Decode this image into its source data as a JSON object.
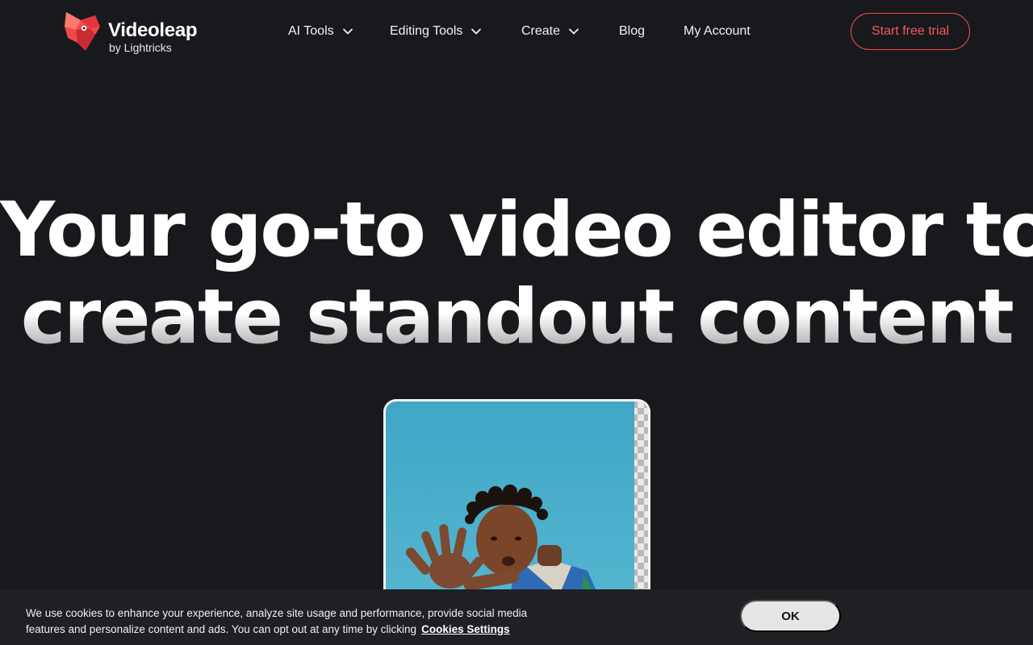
{
  "brand": {
    "name": "Videoleap",
    "sub": "by Lightricks",
    "accent": "#f0494c"
  },
  "nav": {
    "items": [
      {
        "label": "AI Tools",
        "dropdown": true
      },
      {
        "label": "Editing Tools",
        "dropdown": true
      },
      {
        "label": "Create",
        "dropdown": true
      },
      {
        "label": "Blog",
        "dropdown": false
      },
      {
        "label": "My Account",
        "dropdown": false
      }
    ],
    "cta": "Start free trial"
  },
  "hero": {
    "line1": "Your go-to video editor to",
    "line2": "create standout content"
  },
  "cookie": {
    "text": "We use cookies to enhance your experience, analyze site usage and performance, provide social media features and personalize content and ads. You can opt out at any time by clicking",
    "link": "Cookies Settings",
    "ok": "OK"
  },
  "icons": [
    "videoleap-logo-icon",
    "chevron-down-icon"
  ]
}
